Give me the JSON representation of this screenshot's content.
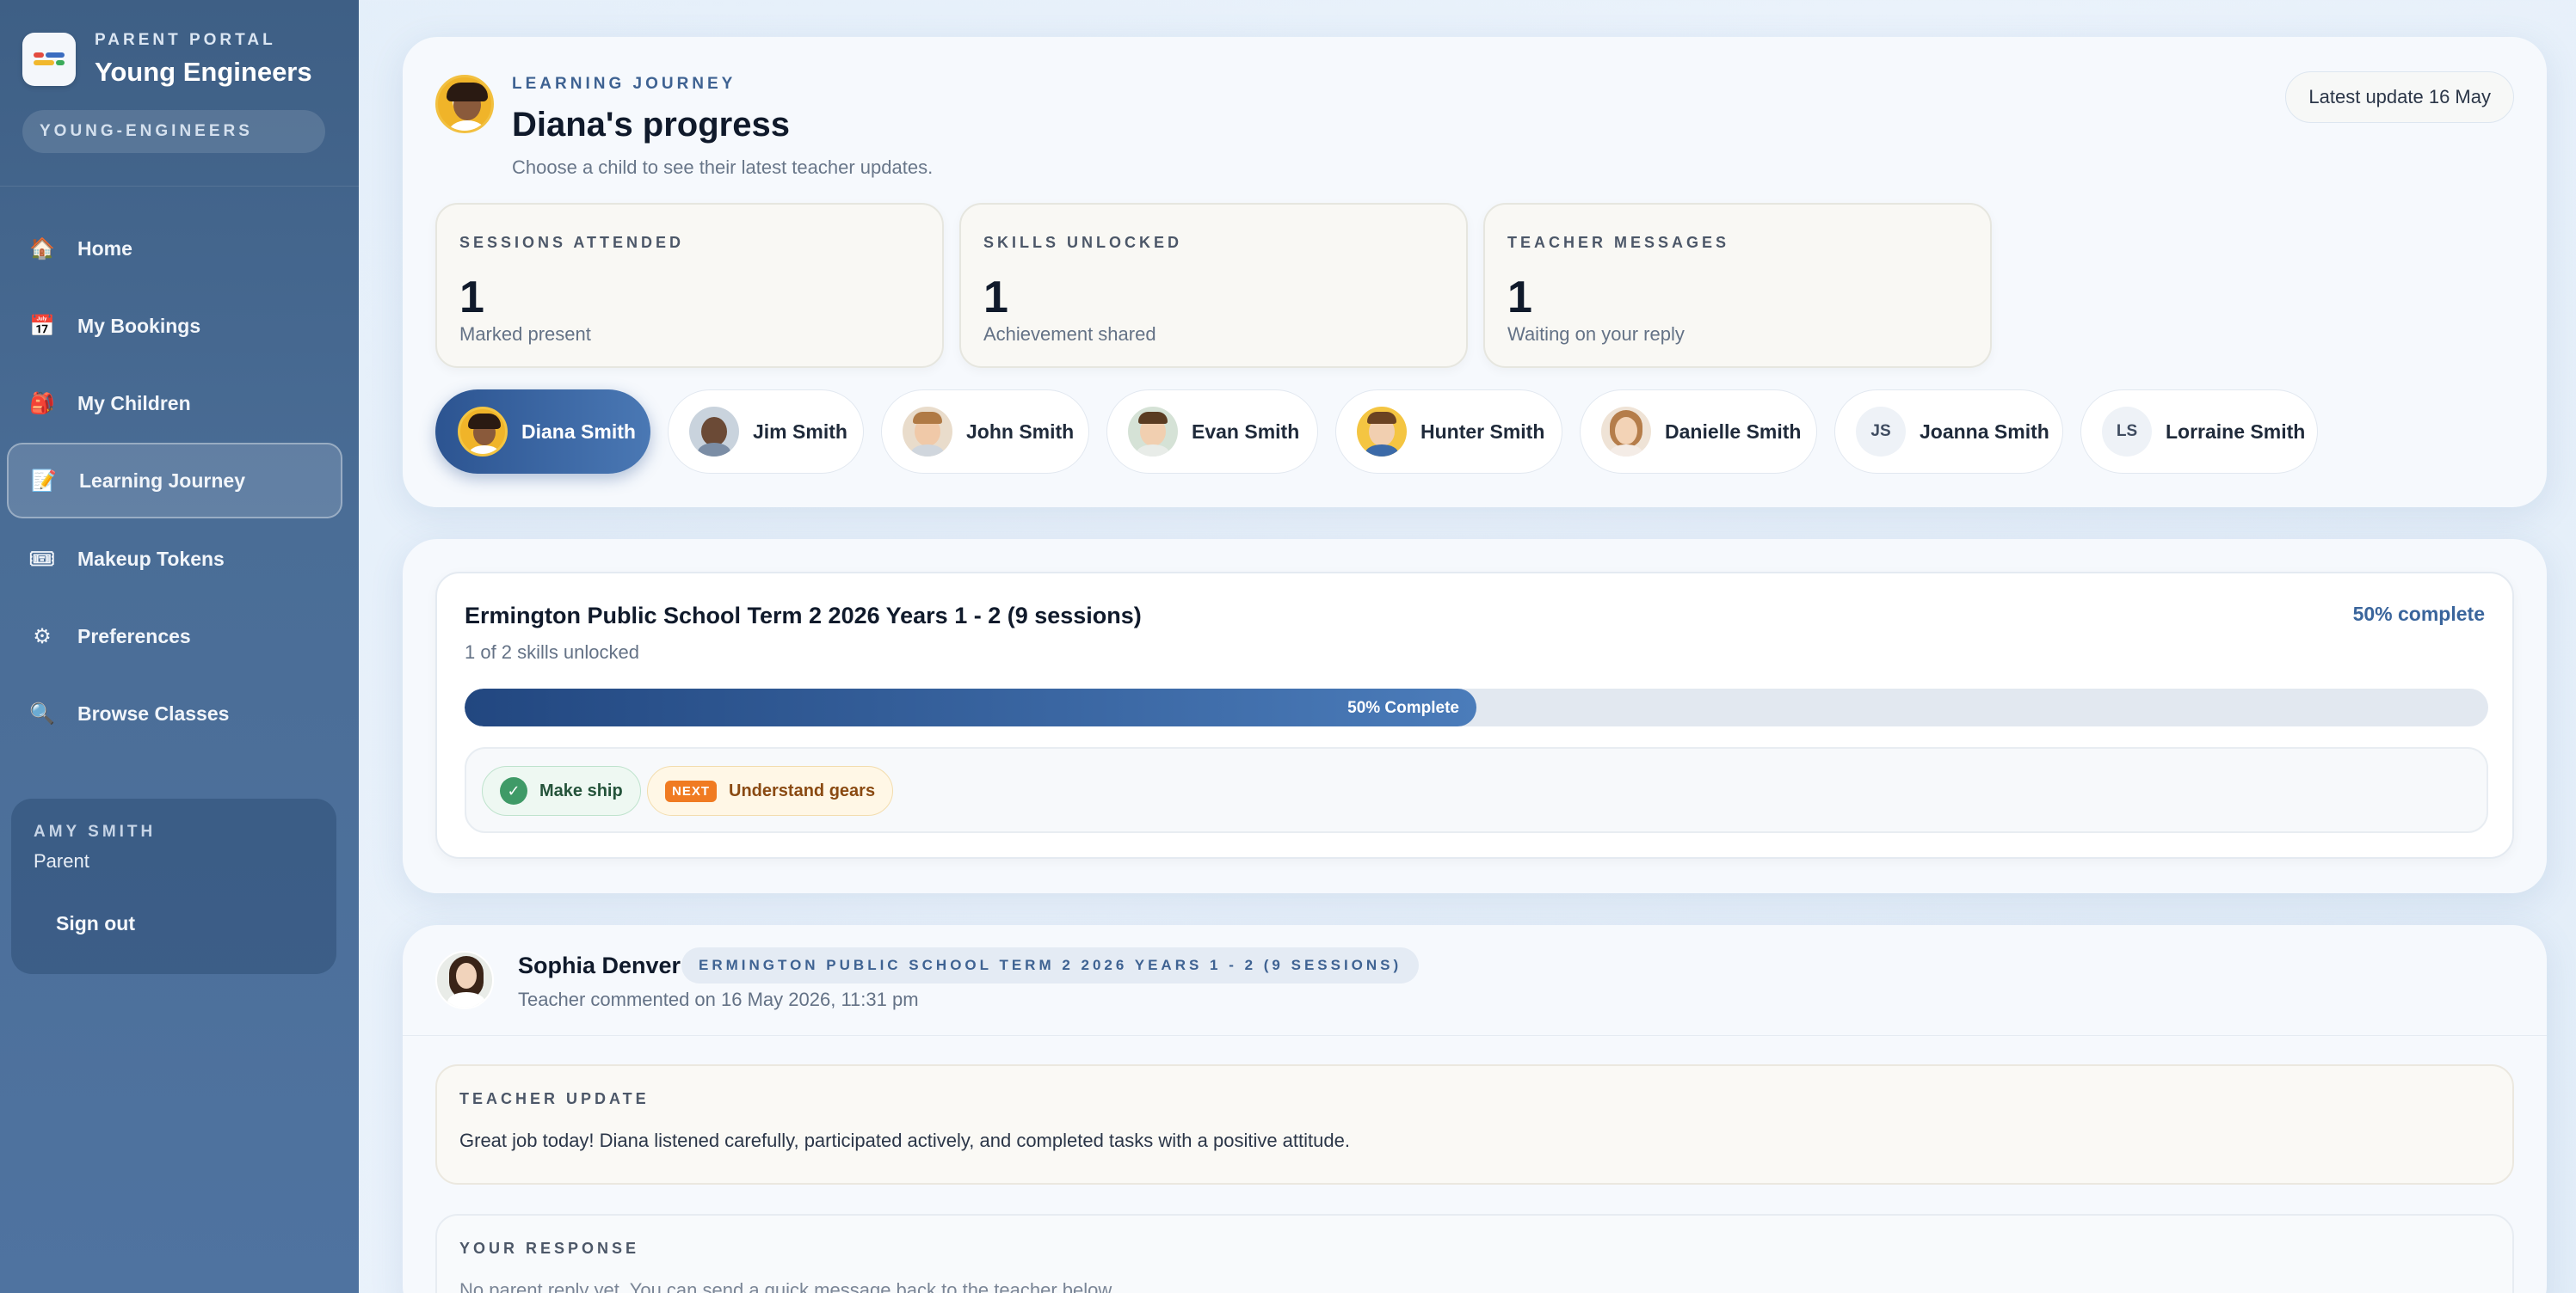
{
  "brand": {
    "kicker": "PARENT PORTAL",
    "name": "Young Engineers",
    "slug": "YOUNG-ENGINEERS"
  },
  "nav": [
    {
      "label": "Home",
      "icon": "home-icon",
      "glyph": "🏠",
      "active": false
    },
    {
      "label": "My Bookings",
      "icon": "calendar-icon",
      "glyph": "📅",
      "active": false
    },
    {
      "label": "My Children",
      "icon": "backpack-icon",
      "glyph": "🎒",
      "active": false
    },
    {
      "label": "Learning Journey",
      "icon": "memo-icon",
      "glyph": "📝",
      "active": true
    },
    {
      "label": "Makeup Tokens",
      "icon": "ticket-icon",
      "glyph": "🎟",
      "active": false
    },
    {
      "label": "Preferences",
      "icon": "gear-icon",
      "glyph": "⚙",
      "active": false
    },
    {
      "label": "Browse Classes",
      "icon": "magnifier-icon",
      "glyph": "🔍",
      "active": false
    }
  ],
  "user": {
    "name": "AMY SMITH",
    "role": "Parent",
    "signout": "Sign out"
  },
  "header": {
    "kicker": "LEARNING JOURNEY",
    "title": "Diana's progress",
    "subtitle": "Choose a child to see their latest teacher updates.",
    "latest": "Latest update 16 May"
  },
  "stats": [
    {
      "label": "SESSIONS ATTENDED",
      "value": "1",
      "note": "Marked present"
    },
    {
      "label": "SKILLS UNLOCKED",
      "value": "1",
      "note": "Achievement shared"
    },
    {
      "label": "TEACHER MESSAGES",
      "value": "1",
      "note": "Waiting on your reply"
    }
  ],
  "children": [
    {
      "name": "Diana Smith",
      "active": true,
      "initials": ""
    },
    {
      "name": "Jim Smith",
      "active": false,
      "initials": ""
    },
    {
      "name": "John Smith",
      "active": false,
      "initials": ""
    },
    {
      "name": "Evan Smith",
      "active": false,
      "initials": ""
    },
    {
      "name": "Hunter Smith",
      "active": false,
      "initials": ""
    },
    {
      "name": "Danielle Smith",
      "active": false,
      "initials": ""
    },
    {
      "name": "Joanna Smith",
      "active": false,
      "initials": "JS"
    },
    {
      "name": "Lorraine Smith",
      "active": false,
      "initials": "LS"
    }
  ],
  "course": {
    "title": "Ermington Public School Term 2 2026 Years 1 - 2 (9 sessions)",
    "sub": "1 of 2 skills unlocked",
    "percent_label": "50% complete",
    "progress": 0.5,
    "bar_label": "50% Complete",
    "skills": [
      {
        "label": "Make ship",
        "status": "done"
      },
      {
        "label": "Understand gears",
        "status": "next",
        "badge": "NEXT"
      }
    ]
  },
  "comment": {
    "teacher": "Sophia Denver",
    "tag": "ERMINGTON PUBLIC SCHOOL TERM 2 2026 YEARS 1 - 2 (9 SESSIONS)",
    "date": "Teacher commented on 16 May 2026, 11:31 pm",
    "update_label": "TEACHER UPDATE",
    "update_text": "Great job today! Diana listened carefully, participated actively, and completed tasks with a positive attitude.",
    "response_label": "YOUR RESPONSE",
    "response_text": "No parent reply yet. You can send a quick message back to the teacher below."
  },
  "colors": {
    "accent": "#2c5491",
    "sidebar": "#4a6d96",
    "success": "#3f9a67",
    "next": "#f07b22"
  }
}
